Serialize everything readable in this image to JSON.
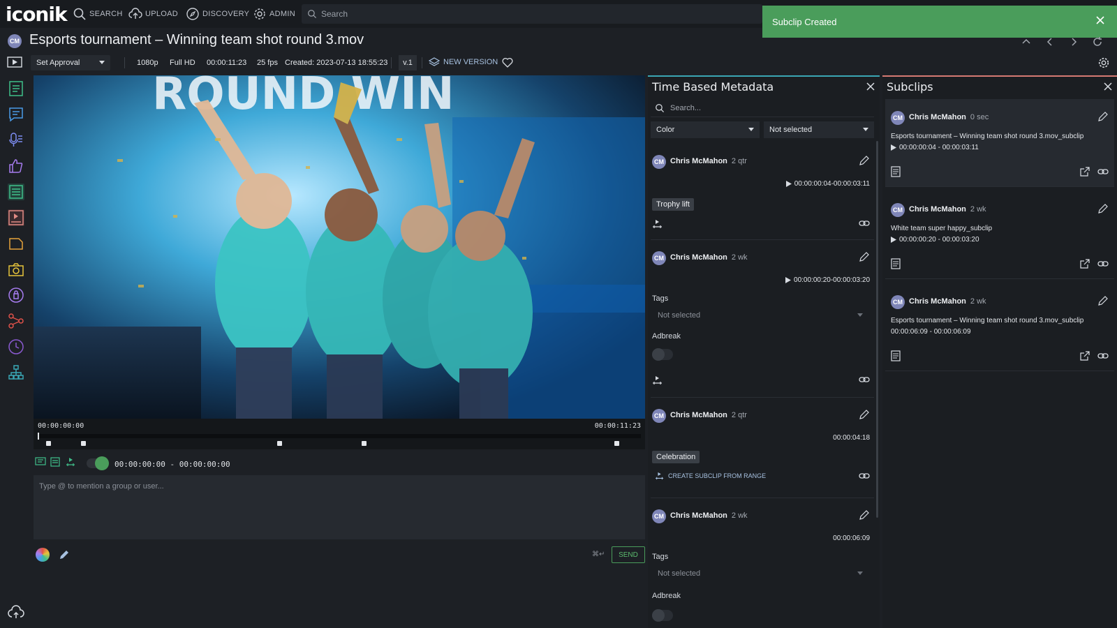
{
  "topnav": {
    "logo": "iconik",
    "items": [
      {
        "label": "SEARCH",
        "icon": "search-icon"
      },
      {
        "label": "UPLOAD",
        "icon": "cloud-upload-icon"
      },
      {
        "label": "DISCOVERY",
        "icon": "compass-icon"
      },
      {
        "label": "ADMIN",
        "icon": "gear-icon"
      }
    ],
    "search_placeholder": "Search"
  },
  "toast": {
    "message": "Subclip Created",
    "color": "#4a9d5b"
  },
  "asset": {
    "avatar": "CM",
    "title": "Esports tournament – Winning team shot round 3.mov"
  },
  "toolbar": {
    "approval": "Set Approval",
    "resolution": "1080p",
    "quality": "Full HD",
    "duration": "00:00:11:23",
    "fps": "25 fps",
    "created": "Created: 2023-07-13 18:55:23",
    "version": "v.1",
    "new_version": "NEW VERSION"
  },
  "player": {
    "tc_start": "00:00:00:00",
    "tc_end": "00:00:11:23",
    "range": "00:00:00:00 - 00:00:00:00",
    "comment_placeholder": "Type @ to mention a group or user...",
    "send": "SEND",
    "shortcut": "⌘↵",
    "markers": [
      0.017,
      0.075,
      0.4,
      0.54,
      0.96
    ]
  },
  "tbm": {
    "title": "Time Based Metadata",
    "search_placeholder": "Search...",
    "filter_field": "Color",
    "filter_value": "Not selected",
    "cards": [
      {
        "avatar": "CM",
        "user": "Chris McMahon",
        "ago": "2 qtr",
        "range": "00:00:00:04-00:00:03:11",
        "chip": "Trophy lift"
      },
      {
        "avatar": "CM",
        "user": "Chris McMahon",
        "ago": "2 wk",
        "range": "00:00:00:20-00:00:03:20",
        "tags_label": "Tags",
        "tags_value": "Not selected",
        "adbreak_label": "Adbreak"
      },
      {
        "avatar": "CM",
        "user": "Chris McMahon",
        "ago": "2 qtr",
        "range": "00:00:04:18",
        "chip": "Celebration",
        "action": "CREATE SUBCLIP FROM RANGE"
      },
      {
        "avatar": "CM",
        "user": "Chris McMahon",
        "ago": "2 wk",
        "range": "00:00:06:09",
        "tags_label": "Tags",
        "tags_value": "Not selected",
        "adbreak_label": "Adbreak"
      }
    ]
  },
  "subclips": {
    "title": "Subclips",
    "items": [
      {
        "avatar": "CM",
        "user": "Chris McMahon",
        "ago": "0 sec",
        "name": "Esports tournament – Winning team shot round 3.mov_subclip",
        "range": "00:00:00:04 - 00:00:03:11",
        "play": true
      },
      {
        "avatar": "CM",
        "user": "Chris McMahon",
        "ago": "2 wk",
        "name": "White team super happy_subclip",
        "range": "00:00:00:20 - 00:00:03:20",
        "play": true
      },
      {
        "avatar": "CM",
        "user": "Chris McMahon",
        "ago": "2 wk",
        "name": "Esports tournament – Winning team shot round 3.mov_subclip",
        "range": "00:00:06:09 - 00:00:06:09",
        "play": false
      }
    ]
  }
}
